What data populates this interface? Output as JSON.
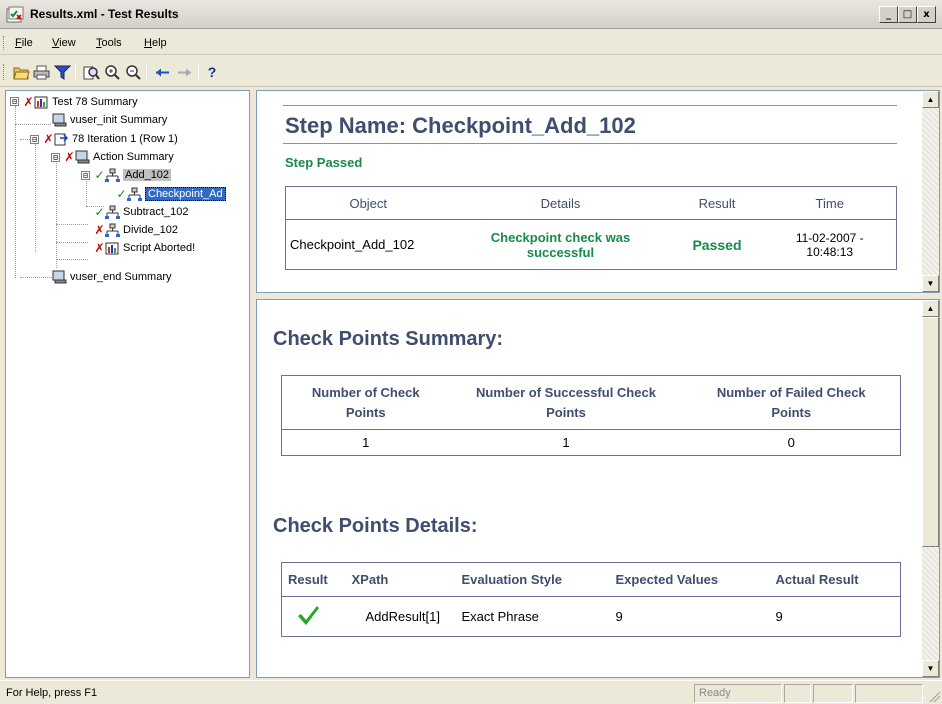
{
  "window": {
    "title": "Results.xml - Test Results",
    "buttons": [
      "_",
      "□",
      "x"
    ]
  },
  "menu": [
    {
      "label": "File",
      "accel": "F"
    },
    {
      "label": "View",
      "accel": "V"
    },
    {
      "label": "Tools",
      "accel": "T"
    },
    {
      "label": "Help",
      "accel": "H"
    }
  ],
  "toolbar": {
    "icons": [
      "open-folder-icon",
      "print-icon",
      "filter-icon",
      "find-icon",
      "zoom-in-icon",
      "zoom-out-icon",
      "back-arrow-icon",
      "forward-arrow-icon",
      "help-icon"
    ],
    "help_label": "?"
  },
  "tree": {
    "items": [
      {
        "label": "Test 78 Summary",
        "status": "fail"
      },
      {
        "label": "vuser_init Summary",
        "status": "none"
      },
      {
        "label": "78 Iteration 1 (Row 1)",
        "status": "fail"
      },
      {
        "label": "Action Summary",
        "status": "fail"
      },
      {
        "label": "Add_102",
        "status": "pass"
      },
      {
        "label": "Checkpoint_Ad",
        "status": "pass"
      },
      {
        "label": "Subtract_102",
        "status": "pass"
      },
      {
        "label": "Divide_102",
        "status": "fail"
      },
      {
        "label": "Script Aborted!",
        "status": "fail"
      },
      {
        "label": "vuser_end Summary",
        "status": "none"
      }
    ],
    "expanders": [
      "⊟",
      "⊟",
      "⊟",
      "⊟"
    ]
  },
  "step": {
    "title": "Step Name: Checkpoint_Add_102",
    "status": "Step Passed",
    "headers": [
      "Object",
      "Details",
      "Result",
      "Time"
    ],
    "row": {
      "object": "Checkpoint_Add_102",
      "details_line1": "Checkpoint check was",
      "details_line2": "successful",
      "result": "Passed",
      "time_line1": "11-02-2007 -",
      "time_line2": "10:48:13"
    }
  },
  "summary": {
    "title": "Check Points Summary:",
    "headers": [
      [
        "Number of Check",
        "Points"
      ],
      [
        "Number of Successful Check",
        "Points"
      ],
      [
        "Number of Failed Check",
        "Points"
      ]
    ],
    "values": [
      "1",
      "1",
      "0"
    ]
  },
  "details": {
    "title": "Check Points Details:",
    "headers": [
      "Result",
      "XPath",
      "Evaluation Style",
      "Expected Values",
      "Actual Result"
    ],
    "row": {
      "result_icon": "checkmark-icon",
      "xpath": "AddResult[1]",
      "style": "Exact Phrase",
      "expected": "9",
      "actual": "9"
    }
  },
  "status": {
    "help": "For Help, press F1",
    "state": "Ready"
  },
  "colors": {
    "heading": "#3f4d6e",
    "pass": "#188a48",
    "fail": "#c00000",
    "selection": "#316ac5"
  }
}
